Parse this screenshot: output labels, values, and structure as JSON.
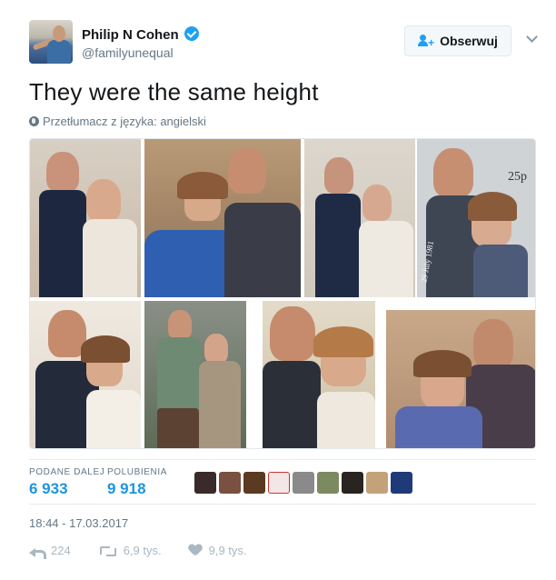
{
  "author": {
    "name": "Philip N Cohen",
    "handle": "@familyunequal",
    "verified": true
  },
  "follow_button": {
    "label": "Obserwuj"
  },
  "tweet": {
    "text": "They were the same height",
    "translate_label": "Przetłumacz z języka: angielski"
  },
  "media": {
    "collage_stamp_text": "25p",
    "collage_stamp_date": "29 July 1981"
  },
  "stats": {
    "retweets_label": "PODANE DALEJ",
    "retweets_value": "6 933",
    "likes_label": "POLUBIENIA",
    "likes_value": "9 918",
    "liker_count": 9
  },
  "timestamp": "18:44 - 17.03.2017",
  "actions": {
    "reply_count": "224",
    "retweet_count": "6,9 tys.",
    "like_count": "9,9 tys."
  },
  "colors": {
    "accent": "#1da1f2",
    "stat_value": "#1b95e0",
    "muted": "#657786",
    "action_gray": "#aab8c2"
  },
  "icons": [
    "verified-badge-icon",
    "follow-user-icon",
    "chevron-down-icon",
    "globe-icon",
    "reply-icon",
    "retweet-icon",
    "heart-icon"
  ]
}
